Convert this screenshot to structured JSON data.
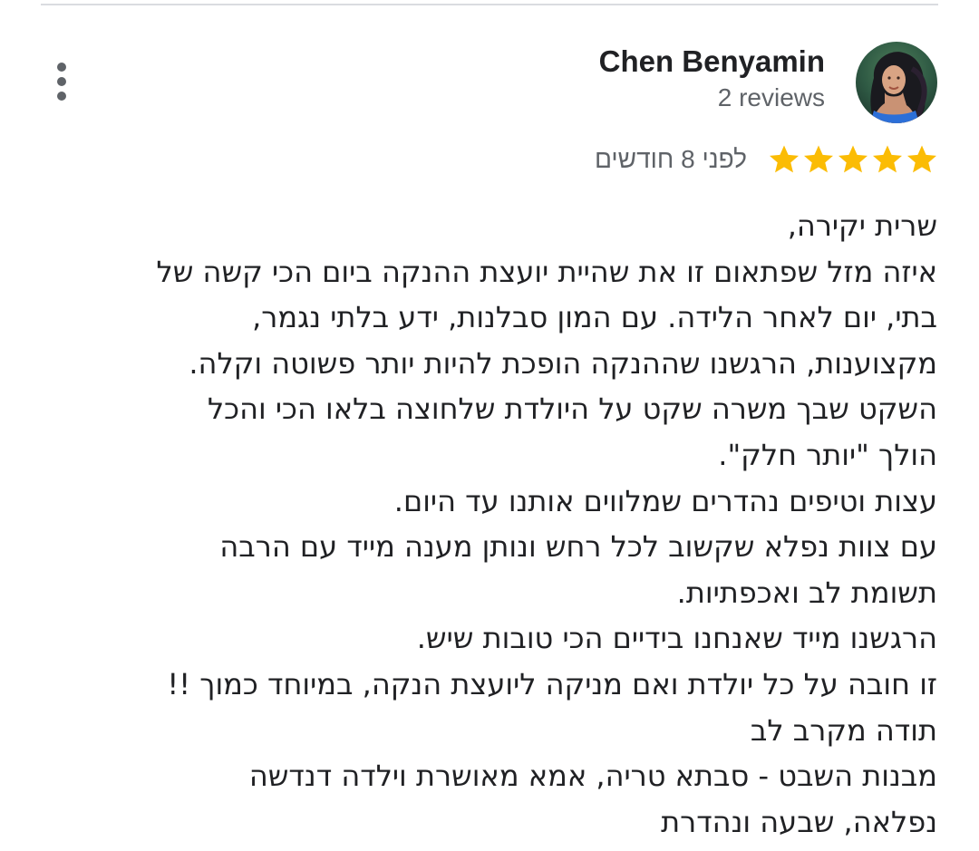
{
  "review": {
    "reviewer": {
      "name": "Chen Benyamin",
      "reviews_count": "2 reviews",
      "avatar_icon": "user-photo"
    },
    "rating": {
      "stars": 5,
      "max": 5,
      "star_color": "#fbbc04"
    },
    "date": "לפני 8 חודשים",
    "menu_icon": "more-vert-icon",
    "text_lines": [
      "שרית יקירה,",
      "איזה מזל שפתאום זו את שהיית יועצת ההנקה ביום הכי קשה של",
      "בתי, יום לאחר הלידה. עם המון סבלנות, ידע בלתי נגמר,",
      "מקצוענות, הרגשנו שההנקה הופכת להיות יותר פשוטה וקלה.",
      "השקט שבך משרה שקט על היולדת שלחוצה בלאו הכי והכל",
      "הולך \"יותר חלק\".",
      "עצות וטיפים נהדרים שמלווים אותנו עד היום.",
      "עם צוות נפלא שקשוב לכל רחש ונותן מענה מייד עם הרבה",
      "תשומת לב ואכפתיות.",
      "הרגשנו מייד שאנחנו בידיים הכי טובות שיש.",
      "זו חובה על כל יולדת ואם מניקה ליועצת הנקה, במיוחד כמוך !!",
      "תודה מקרב לב",
      "מבנות השבט - סבתא טריה, אמא מאושרת וילדה דנדשה",
      "נפלאה, שבעה ונהדרת"
    ]
  }
}
